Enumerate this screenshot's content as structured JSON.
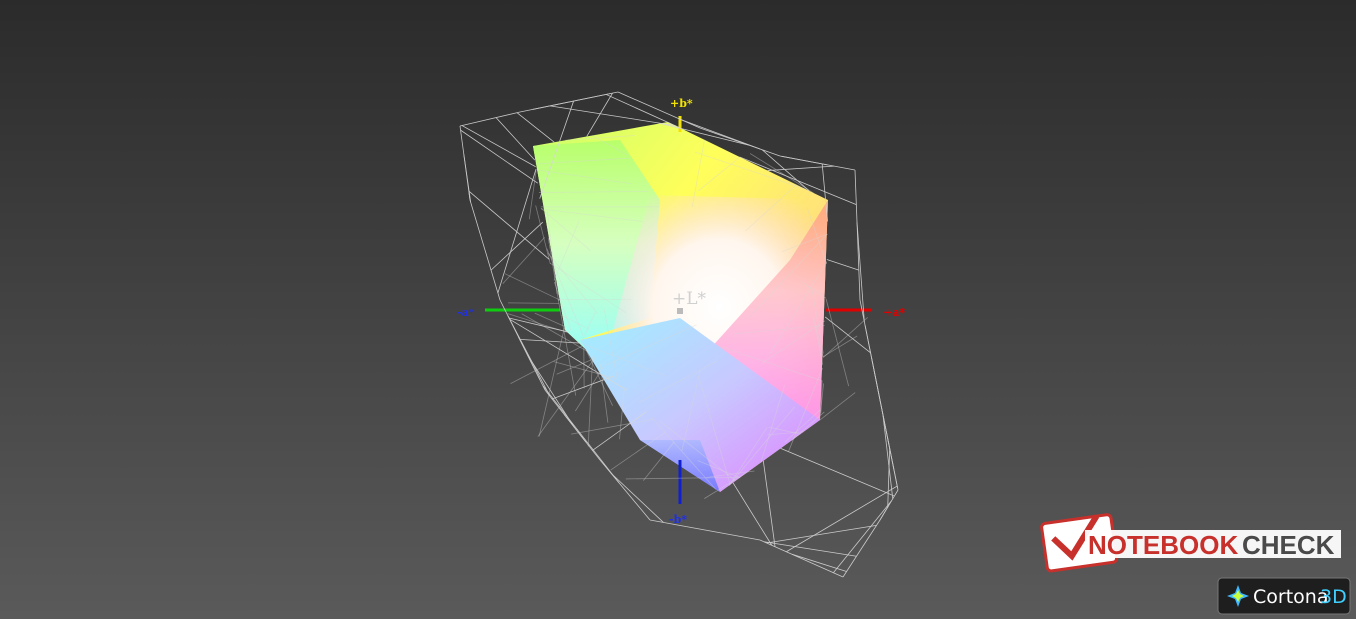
{
  "axes": {
    "plus_b": "+b*",
    "minus_b": "-b*",
    "plus_a": "+a*",
    "minus_a": "-a*",
    "plus_L": "+L*"
  },
  "colors": {
    "axis_plus_b": "#f2e300",
    "axis_minus_b": "#1020d0",
    "axis_plus_a": "#e00000",
    "axis_minus_a": "#10cc10",
    "wireframe": "#d8d8d8",
    "brand_red": "#c8302c",
    "brand_gray": "#4a4a4a"
  },
  "branding": {
    "logo_note": "NOTEBOOK",
    "logo_check": "CHECK",
    "viewer_name": "Cortona",
    "viewer_suffix": "3D"
  },
  "icons": {
    "logo": "notebookcheck-logo-icon",
    "viewer": "cortona-star-icon"
  }
}
